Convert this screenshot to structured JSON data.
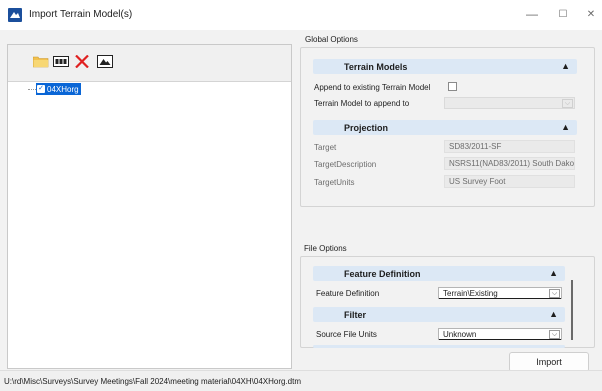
{
  "window": {
    "title": "Import Terrain Model(s)",
    "minimize_glyph": "—",
    "maximize_glyph": "☐",
    "close_glyph": "✕"
  },
  "toolbar": {
    "icons": [
      "open-folder-icon",
      "select-all-icon",
      "delete-icon",
      "terrain-image-icon"
    ]
  },
  "tree": {
    "items": [
      {
        "label": "04XHorg",
        "checked": true,
        "selected": true
      }
    ]
  },
  "global_options": {
    "label": "Global Options",
    "terrain_models": {
      "header": "Terrain Models",
      "append_label": "Append to existing Terrain Model",
      "append_checked": false,
      "append_to_label": "Terrain Model to append to",
      "append_to_value": ""
    },
    "projection": {
      "header": "Projection",
      "rows": [
        {
          "label": "Target",
          "value": "SD83/2011-SF"
        },
        {
          "label": "TargetDescription",
          "value": "NSRS11(NAD83/2011) South Dakot"
        },
        {
          "label": "TargetUnits",
          "value": "US Survey Foot"
        }
      ]
    }
  },
  "file_options": {
    "label": "File Options",
    "feature_definition": {
      "header": "Feature Definition",
      "row_label": "Feature Definition",
      "value": "Terrain\\Existing"
    },
    "filter": {
      "header": "Filter",
      "row_label": "Source File Units",
      "value": "Unknown"
    }
  },
  "buttons": {
    "import_label": "Import"
  },
  "status": {
    "path": "U:\\rd\\Misc\\Surveys\\Survey Meetings\\Fall 2024\\meeting material\\04XH\\04XHorg.dtm"
  },
  "colors": {
    "section_header_bg": "#dce8f5",
    "selection_blue": "#0a66d6",
    "delete_red": "#e02020",
    "folder_yellow": "#f2c14e"
  }
}
